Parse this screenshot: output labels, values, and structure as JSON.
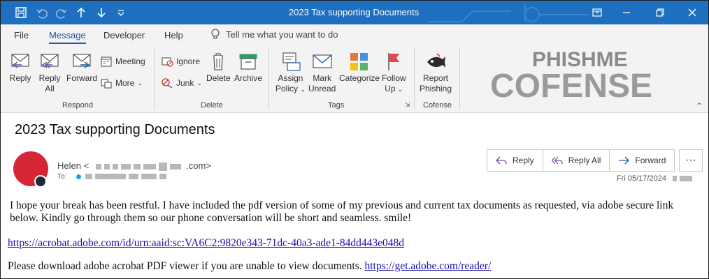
{
  "window": {
    "title": "2023 Tax supporting Documents"
  },
  "menu": {
    "tabs": [
      "File",
      "Message",
      "Developer",
      "Help"
    ],
    "active_tab": "Message",
    "tell_me": "Tell me what you want to do"
  },
  "ribbon": {
    "respond": {
      "reply": "Reply",
      "reply_all_1": "Reply",
      "reply_all_2": "All",
      "forward": "Forward",
      "meeting": "Meeting",
      "more": "More",
      "group": "Respond"
    },
    "delete": {
      "ignore": "Ignore",
      "junk": "Junk",
      "delete": "Delete",
      "archive": "Archive",
      "group": "Delete"
    },
    "tags": {
      "assign_1": "Assign",
      "assign_2": "Policy",
      "mark_1": "Mark",
      "mark_2": "Unread",
      "categorize": "Categorize",
      "follow_1": "Follow",
      "follow_2": "Up",
      "group": "Tags"
    },
    "cofense": {
      "report_1": "Report",
      "report_2": "Phishing",
      "group": "Cofense",
      "logo_top": "PHISHME",
      "logo_bottom": "COFENSE"
    }
  },
  "message": {
    "subject": "2023 Tax supporting Documents",
    "sender_name": "Helen <",
    "sender_domain_suffix": ".com>",
    "to_label": "To:",
    "date": "Fri 05/17/2024",
    "actions": {
      "reply": "Reply",
      "reply_all": "Reply All",
      "forward": "Forward",
      "more": "···"
    },
    "body": {
      "para1": "I hope your break has been restful. I have included the pdf version of some of my previous and current tax documents as requested, via adobe secure link below. Kindly go through them so our phone conversation will be short and seamless. smile!",
      "link1": "https://acrobat.adobe.com/id/urn:aaid:sc:VA6C2:9820e343-71dc-40a3-ade1-84dd443e048d",
      "para3": "Please download adobe acrobat PDF viewer if you are unable to view documents.",
      "link2": "https://get.adobe.com/reader/"
    }
  },
  "colors": {
    "titlebar": "#1e6fc0",
    "avatar": "#d52635",
    "accent": "#1f5ba8"
  }
}
